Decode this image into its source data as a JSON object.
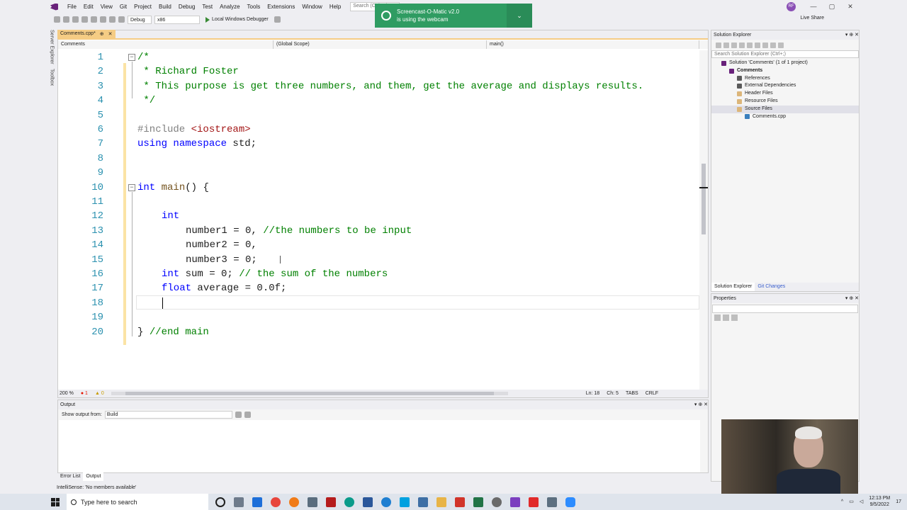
{
  "menubar": {
    "items": [
      "File",
      "Edit",
      "View",
      "Git",
      "Project",
      "Build",
      "Debug",
      "Test",
      "Analyze",
      "Tools",
      "Extensions",
      "Window",
      "Help"
    ],
    "search_placeholder": "Search (Ctrl+Q)",
    "avatar": "RF",
    "window_buttons": [
      "—",
      "▢",
      "✕"
    ]
  },
  "toolbar": {
    "config": "Debug",
    "platform": "x86",
    "run_label": "Local Windows Debugger",
    "live_share": "Live Share"
  },
  "notification": {
    "title": "Screencast-O-Matic v2.0",
    "message": "is using the webcam",
    "chevron": "⌄"
  },
  "left_strip": [
    "Server Explorer",
    "Toolbox"
  ],
  "editor": {
    "tab_label": "Comments.cpp*",
    "tab_pin": "⊕",
    "tab_close": "✕",
    "nav_project": "Comments",
    "nav_scope": "(Global Scope)",
    "nav_member": "main()",
    "line_numbers": [
      "1",
      "2",
      "3",
      "4",
      "5",
      "6",
      "7",
      "8",
      "9",
      "10",
      "11",
      "12",
      "13",
      "14",
      "15",
      "16",
      "17",
      "18",
      "19",
      "20"
    ],
    "code": {
      "l1": "/*",
      "l2": " * Richard Foster",
      "l3": " * This purpose is get three numbers, and them, get the average and displays results.",
      "l4": " */",
      "l6_directive": "#include ",
      "l6_header": "<iostream>",
      "l7_using": "using",
      "l7_namespace": " namespace",
      "l7_rest": " std;",
      "l10_type": "int",
      "l10_name": " main",
      "l10_rest": "() {",
      "l12_type": "int",
      "l13_code": "number1 = 0, ",
      "l13_comment": "//the numbers to be input",
      "l14_code": "number2 = 0,",
      "l15_code": "number3 = 0;",
      "l16_type": "int",
      "l16_code": " sum = 0; ",
      "l16_comment": "// the sum of the numbers",
      "l17_type": "float",
      "l17_code": " average = 0.0f;",
      "l20_brace": "} ",
      "l20_comment": "//end main"
    },
    "status": {
      "zoom": "200 %",
      "errors": "1",
      "warnings": "0",
      "line": "Ln: 18",
      "col": "Ch: 5",
      "tabs": "TABS",
      "eol": "CRLF"
    }
  },
  "solution_explorer": {
    "title": "Solution Explorer",
    "search_placeholder": "Search Solution Explorer (Ctrl+;)",
    "tree": [
      {
        "label": "Solution 'Comments' (1 of 1 project)",
        "indent": 0,
        "bold": false,
        "color": "#68217a"
      },
      {
        "label": "Comments",
        "indent": 1,
        "bold": true,
        "color": "#68217a"
      },
      {
        "label": "References",
        "indent": 2,
        "bold": false,
        "color": "#5a5a5a"
      },
      {
        "label": "External Dependencies",
        "indent": 2,
        "bold": false,
        "color": "#5a5a5a"
      },
      {
        "label": "Header Files",
        "indent": 2,
        "bold": false,
        "color": "#dcb67a"
      },
      {
        "label": "Resource Files",
        "indent": 2,
        "bold": false,
        "color": "#dcb67a"
      },
      {
        "label": "Source Files",
        "indent": 2,
        "bold": false,
        "color": "#dcb67a"
      },
      {
        "label": "Comments.cpp",
        "indent": 3,
        "bold": false,
        "color": "#3a7fbd"
      }
    ],
    "tabs": [
      "Solution Explorer",
      "Git Changes"
    ]
  },
  "properties": {
    "title": "Properties"
  },
  "output": {
    "title": "Output",
    "show_from_label": "Show output from:",
    "source": "Build",
    "tabs": [
      "Error List",
      "Output"
    ]
  },
  "statusbar": {
    "message": "IntelliSense: 'No members available'"
  },
  "taskbar": {
    "search_placeholder": "Type here to search",
    "time": "12:13 PM",
    "date": "9/5/2022",
    "notification_count": "17"
  },
  "colors": {
    "keyword": "#0000ff",
    "comment": "#008000",
    "line_number": "#2b91af",
    "notification": "#2f9c62",
    "vs_accent": "#68217a"
  }
}
